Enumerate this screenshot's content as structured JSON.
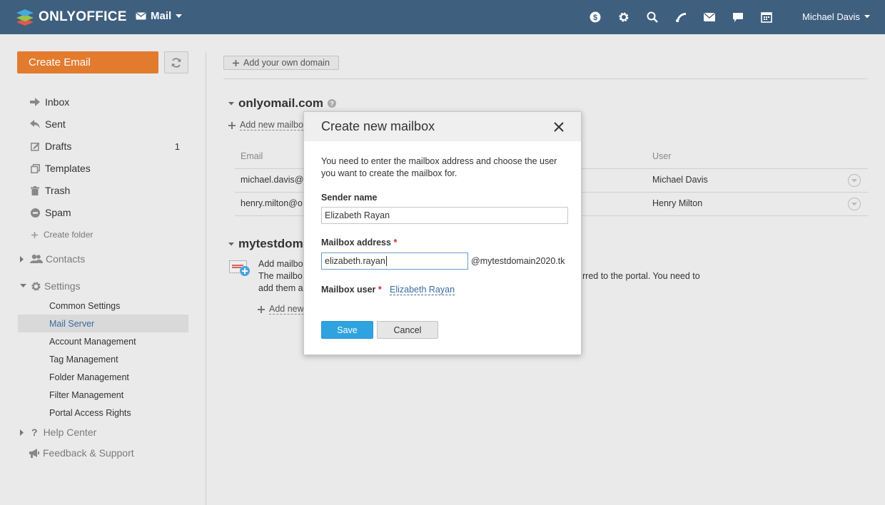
{
  "header": {
    "logo_text": "ONLYOFFICE",
    "module": "Mail",
    "user": "Michael Davis",
    "icons": [
      "dollar-icon",
      "gear-icon",
      "search-icon",
      "feed-icon",
      "mail-icon",
      "chat-icon",
      "calendar-icon"
    ]
  },
  "sidebar": {
    "create_email": "Create Email",
    "folders": [
      {
        "label": "Inbox",
        "icon": "inbox-arrow-icon",
        "count": ""
      },
      {
        "label": "Sent",
        "icon": "reply-icon",
        "count": ""
      },
      {
        "label": "Drafts",
        "icon": "edit-icon",
        "count": "1"
      },
      {
        "label": "Templates",
        "icon": "copy-icon",
        "count": ""
      },
      {
        "label": "Trash",
        "icon": "trash-icon",
        "count": ""
      },
      {
        "label": "Spam",
        "icon": "block-icon",
        "count": ""
      }
    ],
    "create_folder": "Create folder",
    "contacts": "Contacts",
    "settings": "Settings",
    "settings_items": [
      "Common Settings",
      "Mail Server",
      "Account Management",
      "Tag Management",
      "Folder Management",
      "Filter Management",
      "Portal Access Rights"
    ],
    "help_center": "Help Center",
    "feedback": "Feedback & Support"
  },
  "main": {
    "add_domain": "Add your own domain",
    "domain1": "onlyomail.com",
    "add_mailbox_prefix": "Add new mailbo",
    "col_email": "Email",
    "col_user": "User",
    "rows": [
      {
        "email": "michael.davis@c",
        "user": "Michael Davis"
      },
      {
        "email": "henry.milton@o",
        "user": "Henry Milton"
      }
    ],
    "domain2": "mytestdom",
    "help_line1": "Add mailbo",
    "help_line2_a": "The mailbo",
    "help_line2_b": "rred to the portal. You need to",
    "help_line3": "add them a",
    "add_new_prefix": "Add new"
  },
  "dialog": {
    "title": "Create new mailbox",
    "text": "You need to enter the mailbox address and choose the user you want to create the mailbox for.",
    "sender_label": "Sender name",
    "sender_value": "Elizabeth Rayan",
    "address_label": "Mailbox address",
    "address_value": "elizabeth.rayan",
    "domain_suffix": "@mytestdomain2020.tk",
    "user_label": "Mailbox user",
    "user_value": "Elizabeth Rayan",
    "required_mark": "*",
    "save": "Save",
    "cancel": "Cancel"
  }
}
